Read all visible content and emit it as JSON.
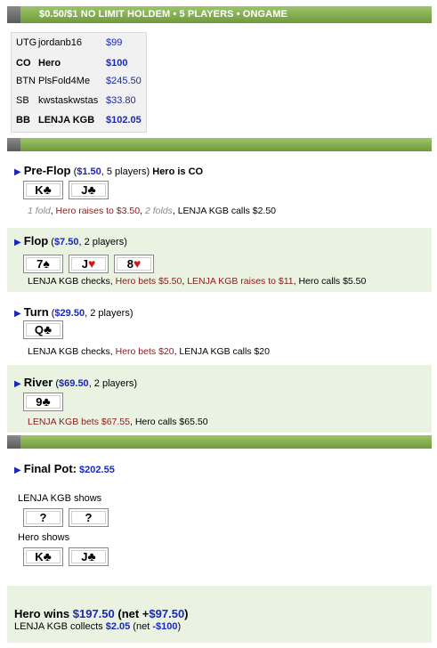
{
  "header": {
    "title": "$0.50/$1 NO LIMIT HOLDEM • 5 PLAYERS • ONGAME"
  },
  "players": [
    {
      "pos": "UTG",
      "name": "jordanb16",
      "stack": "$99",
      "bold": false
    },
    {
      "pos": "CO",
      "name": "Hero",
      "stack": "$100",
      "bold": true
    },
    {
      "pos": "BTN",
      "name": "PlsFold4Me",
      "stack": "$245.50",
      "bold": false
    },
    {
      "pos": "SB",
      "name": "kwstaskwstas",
      "stack": "$33.80",
      "bold": false
    },
    {
      "pos": "BB",
      "name": "LENJA KGB",
      "stack": "$102.05",
      "bold": true
    }
  ],
  "preflop": {
    "name": "Pre-Flop",
    "open": "(",
    "pot": "$1.50",
    "info": ", 5 players)",
    "hero": "Hero is CO",
    "cards": [
      {
        "rank": "K",
        "suit": "♣",
        "color": "black"
      },
      {
        "rank": "J",
        "suit": "♣",
        "color": "black"
      }
    ],
    "actions": [
      {
        "text": "1 fold",
        "style": "fold"
      },
      {
        "text": ", ",
        "style": "plain"
      },
      {
        "text": "Hero raises to $3.50",
        "style": "hero"
      },
      {
        "text": ", ",
        "style": "plain"
      },
      {
        "text": "2 folds",
        "style": "fold"
      },
      {
        "text": ", LENJA KGB calls $2.50",
        "style": "plain"
      }
    ]
  },
  "flop": {
    "name": "Flop",
    "open": "(",
    "pot": "$7.50",
    "info": ", 2 players)",
    "cards": [
      {
        "rank": "7",
        "suit": "♠",
        "color": "black"
      },
      {
        "rank": "J",
        "suit": "♥",
        "color": "red"
      },
      {
        "rank": "8",
        "suit": "♥",
        "color": "red"
      }
    ],
    "actions": [
      {
        "text": "LENJA KGB checks, ",
        "style": "plain"
      },
      {
        "text": "Hero bets $5.50",
        "style": "hero"
      },
      {
        "text": ", ",
        "style": "plain"
      },
      {
        "text": "LENJA KGB raises to $11",
        "style": "raise"
      },
      {
        "text": ", Hero calls $5.50",
        "style": "plain"
      }
    ]
  },
  "turn": {
    "name": "Turn",
    "open": "(",
    "pot": "$29.50",
    "info": ", 2 players)",
    "cards": [
      {
        "rank": "Q",
        "suit": "♣",
        "color": "black"
      }
    ],
    "actions": [
      {
        "text": "LENJA KGB checks, ",
        "style": "plain"
      },
      {
        "text": "Hero bets $20",
        "style": "hero"
      },
      {
        "text": ", LENJA KGB calls $20",
        "style": "plain"
      }
    ]
  },
  "river": {
    "name": "River",
    "open": "(",
    "pot": "$69.50",
    "info": ", 2 players)",
    "cards": [
      {
        "rank": "9",
        "suit": "♣",
        "color": "black"
      }
    ],
    "actions": [
      {
        "text": "LENJA KGB bets $67.55",
        "style": "raise"
      },
      {
        "text": ", Hero calls $65.50",
        "style": "plain"
      }
    ]
  },
  "final": {
    "name": "Final Pot:",
    "pot": "$202.55",
    "villain_label": "LENJA KGB shows",
    "villain_cards": [
      {
        "rank": "?",
        "suit": "",
        "color": "black"
      },
      {
        "rank": "?",
        "suit": "",
        "color": "black"
      }
    ],
    "hero_label": "Hero shows",
    "hero_cards": [
      {
        "rank": "K",
        "suit": "♣",
        "color": "black"
      },
      {
        "rank": "J",
        "suit": "♣",
        "color": "black"
      }
    ]
  },
  "summary": {
    "wins_prefix": "Hero wins ",
    "wins_amount": "$197.50",
    "net_prefix": " (net +",
    "net_amount": "$97.50",
    "net_suffix": ")",
    "collects_prefix": "LENJA KGB collects ",
    "collects_amount": "$2.05",
    "collects_net_prefix": " (net ",
    "collects_net_amount": "-$100",
    "collects_net_suffix": ")"
  },
  "icons": {
    "street_marker": "▶"
  },
  "colors": {
    "bar_green": "#7fa84a",
    "pot_blue": "#1a28b8",
    "hero_action": "#8b1a1a",
    "shaded_bg": "#eaf3e2"
  }
}
